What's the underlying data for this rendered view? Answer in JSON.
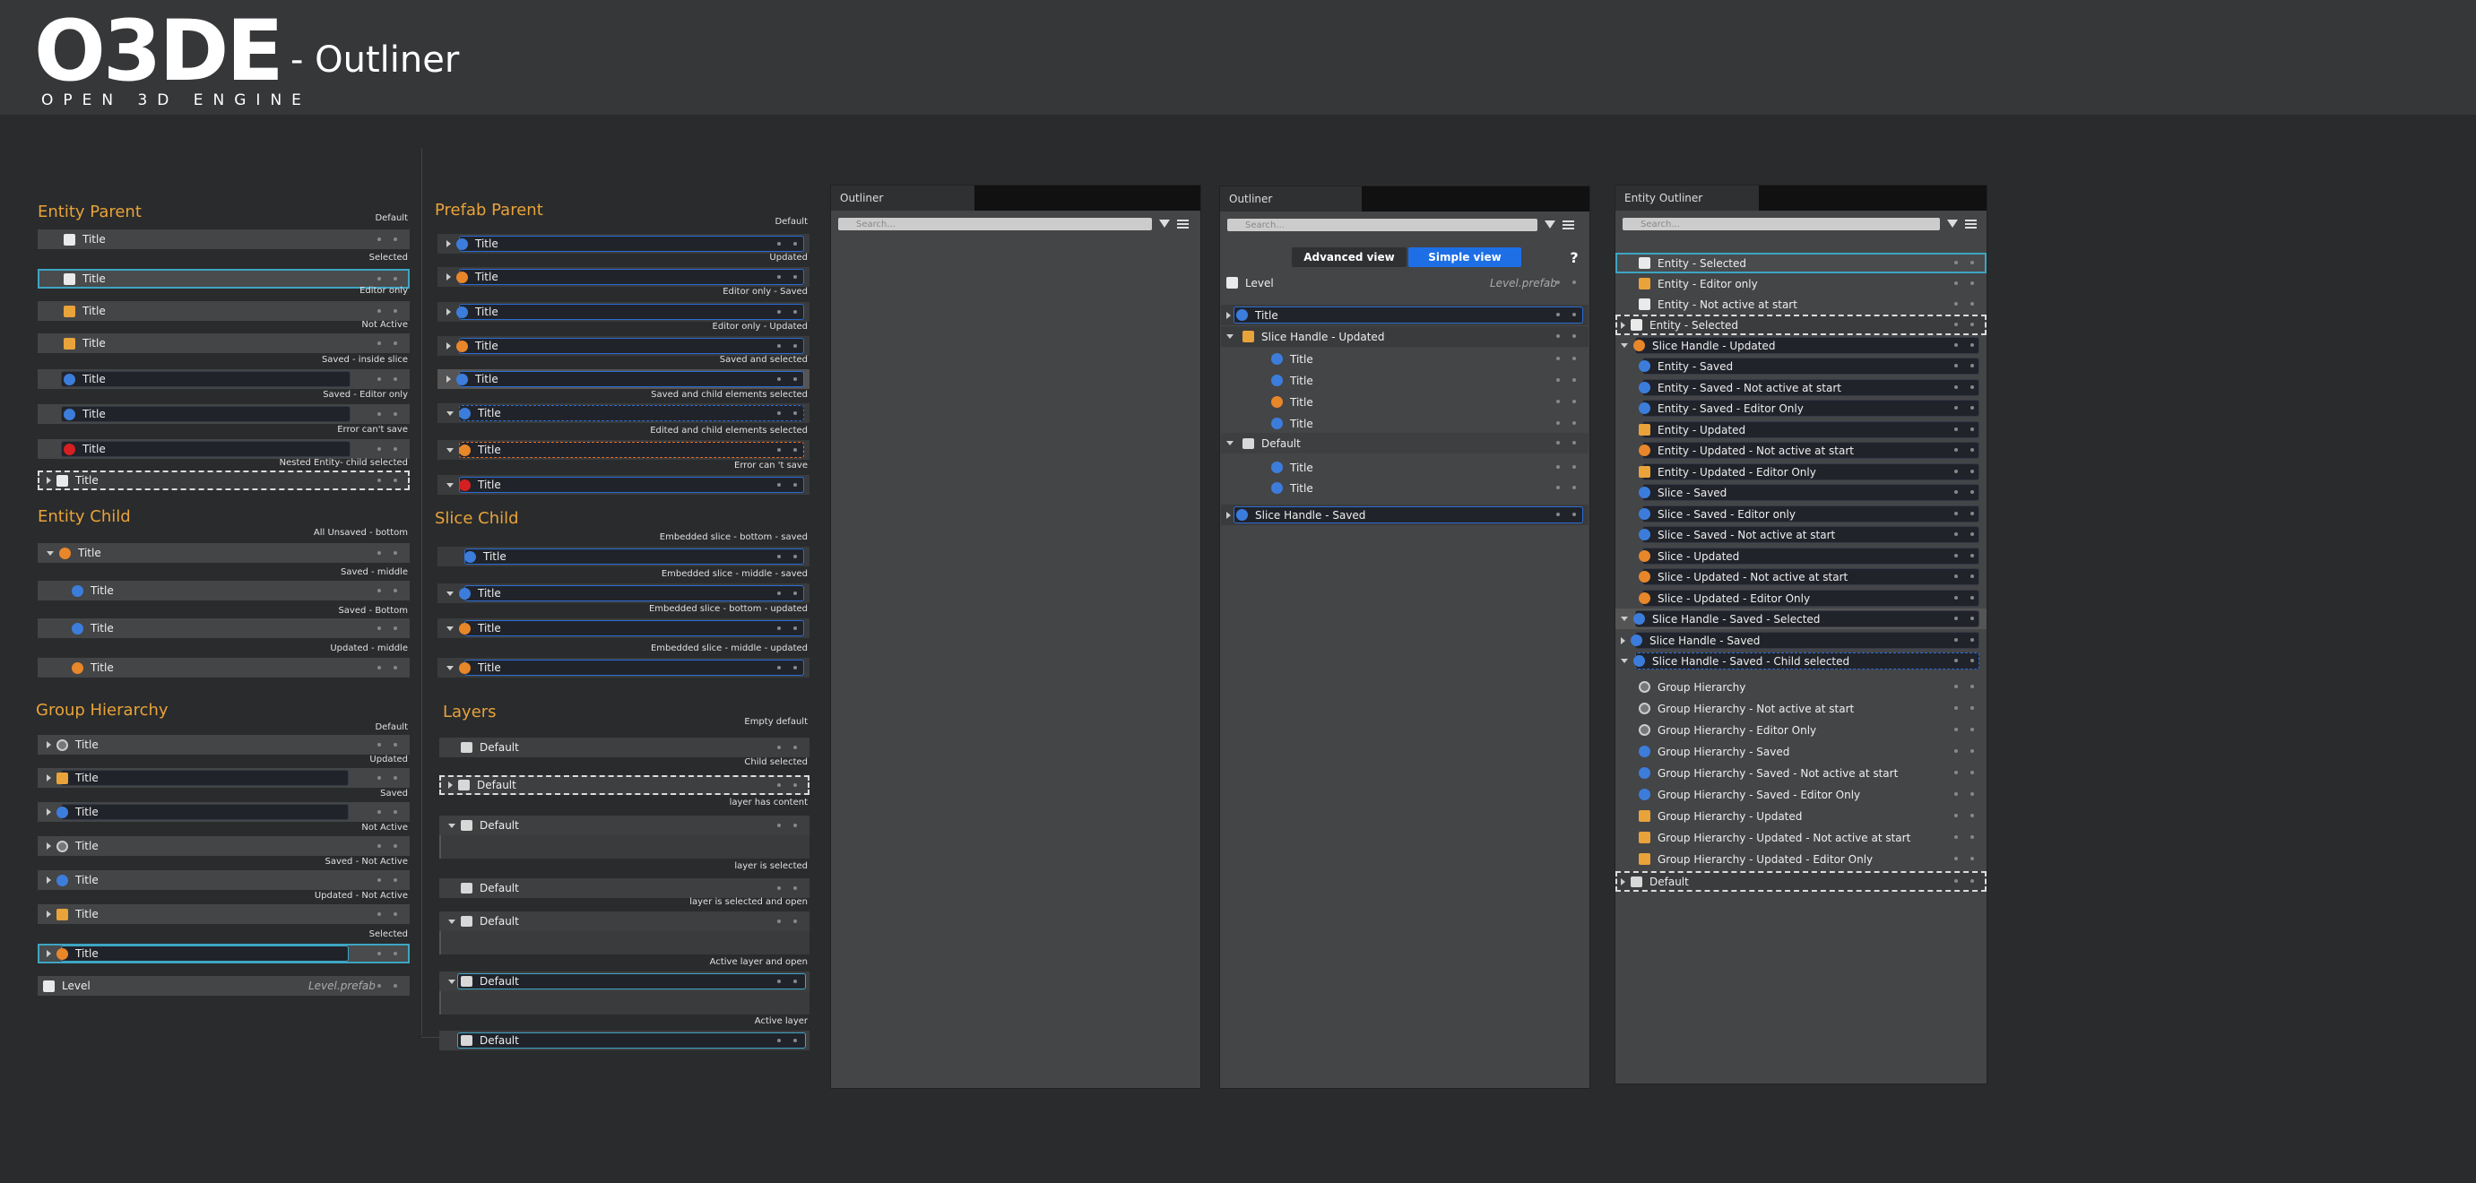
{
  "brand": {
    "logo": "O3DE",
    "tagline": "OPEN 3D ENGINE",
    "page_title": "- Outliner"
  },
  "entity_parent": {
    "heading": "Entity Parent",
    "rows": [
      {
        "state": "Default",
        "label": "Title"
      },
      {
        "state": "Selected",
        "label": "Title"
      },
      {
        "state": "Editor only",
        "label": "Title"
      },
      {
        "state": "Not Active",
        "label": "Title"
      },
      {
        "state": "Saved  - inside slice",
        "label": "Title"
      },
      {
        "state": "Saved  - Editor only",
        "label": "Title"
      },
      {
        "state": "Error can't save",
        "label": "Title"
      },
      {
        "state": "Nested Entity- child selected",
        "label": "Title"
      }
    ]
  },
  "entity_child": {
    "heading": "Entity Child",
    "rows": [
      {
        "state": "All Unsaved - bottom",
        "label": "Title"
      },
      {
        "state": "Saved - middle",
        "label": "Title"
      },
      {
        "state": "Saved - Bottom",
        "label": "Title"
      },
      {
        "state": "Updated - middle",
        "label": "Title"
      }
    ]
  },
  "group_hierarchy": {
    "heading": "Group Hierarchy",
    "rows": [
      {
        "state": "Default",
        "label": "Title"
      },
      {
        "state": "Updated",
        "label": "Title"
      },
      {
        "state": "Saved",
        "label": "Title"
      },
      {
        "state": "Not Active",
        "label": "Title"
      },
      {
        "state": "Saved - Not Active",
        "label": "Title"
      },
      {
        "state": "Updated - Not Active",
        "label": "Title"
      },
      {
        "state": "Selected",
        "label": "Title"
      }
    ],
    "level": {
      "label": "Level",
      "file": "Level.prefab"
    }
  },
  "prefab_parent": {
    "heading": "Prefab Parent",
    "rows": [
      {
        "state": "Default",
        "label": "Title"
      },
      {
        "state": "Updated",
        "label": "Title"
      },
      {
        "state": "Editor only  - Saved",
        "label": "Title"
      },
      {
        "state": "Editor only - Updated",
        "label": "Title"
      },
      {
        "state": "Saved and selected",
        "label": "Title"
      },
      {
        "state": "Saved and child elements selected",
        "label": "Title"
      },
      {
        "state": "Edited and child elements selected",
        "label": "Title"
      },
      {
        "state": "Error can 't save",
        "label": "Title"
      }
    ]
  },
  "slice_child": {
    "heading": "Slice Child",
    "rows": [
      {
        "state": "Embedded slice - bottom - saved",
        "label": "Title"
      },
      {
        "state": "Embedded slice - middle - saved",
        "label": "Title"
      },
      {
        "state": "Embedded slice - bottom - updated",
        "label": "Title"
      },
      {
        "state": "Embedded slice - middle - updated",
        "label": "Title"
      }
    ]
  },
  "layers": {
    "heading": "Layers",
    "rows": [
      {
        "state": "Empty default",
        "label": "Default"
      },
      {
        "state": "Child selected",
        "label": "Default"
      },
      {
        "state": "layer has content",
        "label": "Default"
      },
      {
        "state": "layer is selected",
        "label": "Default"
      },
      {
        "state": "layer is selected and open",
        "label": "Default"
      },
      {
        "state": "Active layer and open",
        "label": "Default"
      },
      {
        "state": "Active layer",
        "label": "Default"
      }
    ]
  },
  "panel1": {
    "tab": "Outliner",
    "search_placeholder": "Search..."
  },
  "panel2": {
    "tab": "Outliner",
    "search_placeholder": "Search...",
    "advanced_label": "Advanced view",
    "simple_label": "Simple view",
    "help_label": "?",
    "level": {
      "label": "Level",
      "file": "Level.prefab"
    },
    "rows": [
      "Title",
      "Slice Handle - Updated",
      "Title",
      "Title",
      "Title",
      "Title",
      "Default",
      "Title",
      "Title",
      "Slice Handle - Saved"
    ]
  },
  "panel3": {
    "tab": "Entity Outliner",
    "search_placeholder": "Search...",
    "rows": [
      "Entity - Selected",
      "Entity - Editor only",
      "Entity  - Not active at start",
      "Entity - Selected",
      "Slice Handle - Updated",
      "Entity - Saved",
      "Entity - Saved - Not active at start",
      "Entity - Saved - Editor Only",
      "Entity - Updated",
      "Entity - Updated - Not active at start",
      "Entity - Updated - Editor Only",
      "Slice - Saved",
      "Slice - Saved - Editor only",
      "Slice - Saved - Not active at start",
      "Slice - Updated",
      "Slice - Updated - Not active at start",
      "Slice - Updated - Editor Only",
      "Slice Handle - Saved - Selected",
      "Slice Handle - Saved",
      "Slice Handle - Saved - Child selected",
      "Group Hierarchy",
      "Group Hierarchy - Not active at start",
      "Group Hierarchy - Editor Only",
      "Group Hierarchy - Saved",
      "Group Hierarchy - Saved - Not active at start",
      "Group Hierarchy - Saved - Editor Only",
      "Group Hierarchy - Updated",
      "Group Hierarchy - Updated - Not active at start",
      "Group Hierarchy - Updated - Editor Only",
      "Default"
    ]
  }
}
